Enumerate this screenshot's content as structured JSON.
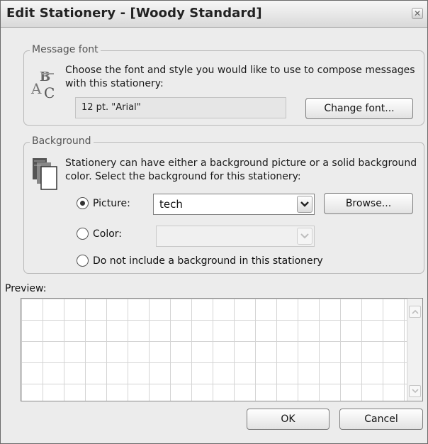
{
  "window": {
    "title": "Edit Stationery - [Woody Standard]",
    "close_glyph": "✕"
  },
  "message_font": {
    "legend": "Message font",
    "icon": "font-abc-icon",
    "description": "Choose the font and style you would like to use to compose messages with this stationery:",
    "font_value": "12 pt. \"Arial\"",
    "change_font_label": "Change font..."
  },
  "background": {
    "legend": "Background",
    "icon": "stacked-pages-icon",
    "description": "Stationery can have either a background picture or a solid background color.  Select the background for this stationery:",
    "options": {
      "picture": {
        "label": "Picture:",
        "selected": true,
        "value": "tech"
      },
      "color": {
        "label": "Color:",
        "selected": false,
        "value": ""
      },
      "none": {
        "label": "Do not include a background in this stationery",
        "selected": false
      }
    },
    "browse_label": "Browse..."
  },
  "preview": {
    "label": "Preview:"
  },
  "footer": {
    "ok_label": "OK",
    "cancel_label": "Cancel"
  },
  "colors": {
    "window_bg": "#ececec",
    "grid_line": "#d4d4d4",
    "border": "#7c7c7c"
  }
}
